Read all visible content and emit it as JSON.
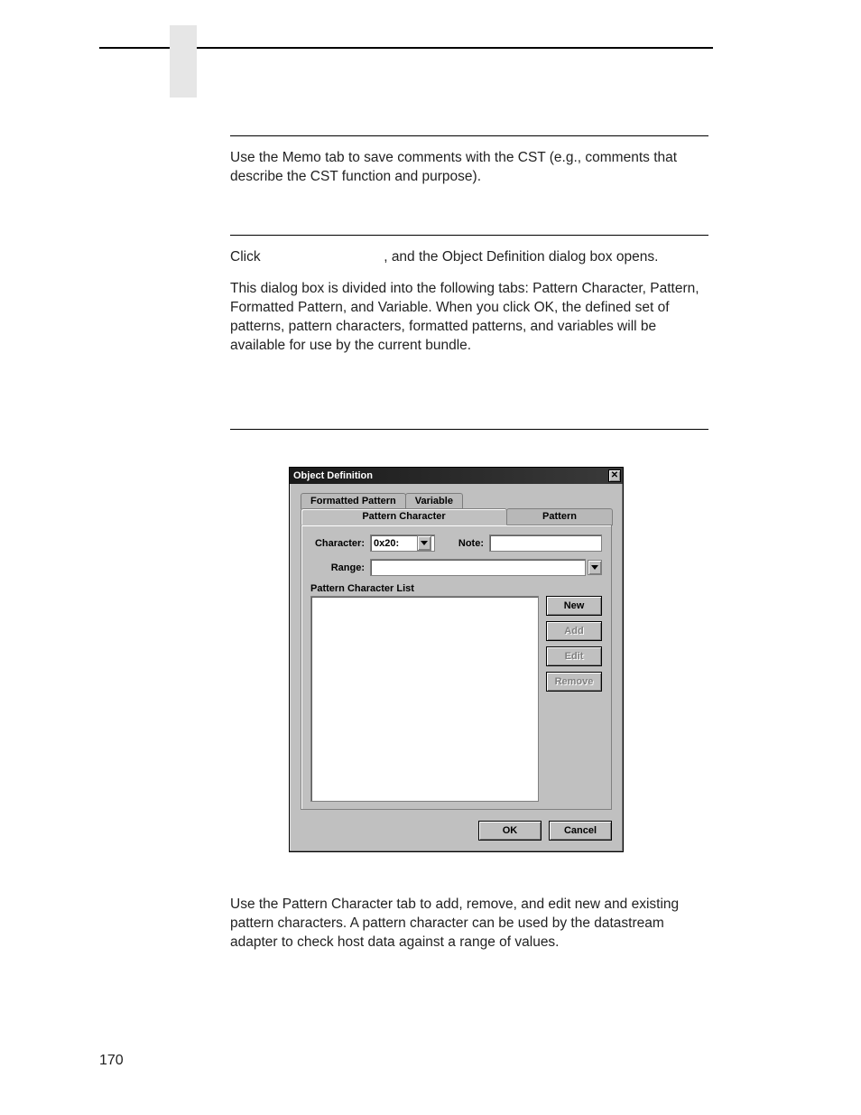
{
  "page_number": "170",
  "sections": {
    "memo": {
      "text": "Use the Memo tab to save comments with the CST (e.g., comments that describe the CST function and purpose)."
    },
    "objdef_intro": {
      "p1_prefix": "Click ",
      "p1_suffix": ", and the Object Definition dialog box opens.",
      "p2": "This dialog box is divided into the following tabs: Pattern Character, Pattern, Formatted Pattern, and Variable. When you click OK, the defined set of patterns, pattern characters, formatted patterns, and variables will be available for use by the current bundle."
    },
    "pattern_char_desc": {
      "text": "Use the Pattern Character tab to add, remove, and edit new and existing pattern characters. A pattern character can be used by the datastream adapter to check host data against a range of values."
    }
  },
  "dialog": {
    "title": "Object Definition",
    "tabs_back": [
      "Formatted Pattern",
      "Variable"
    ],
    "tabs_front": {
      "active": "Pattern Character",
      "inactive": "Pattern"
    },
    "labels": {
      "character": "Character:",
      "note": "Note:",
      "range": "Range:",
      "list_group": "Pattern Character List"
    },
    "fields": {
      "character_value": "0x20:",
      "note_value": "",
      "range_value": ""
    },
    "buttons": {
      "new": "New",
      "add": "Add",
      "edit": "Edit",
      "remove": "Remove",
      "ok": "OK",
      "cancel": "Cancel"
    }
  }
}
